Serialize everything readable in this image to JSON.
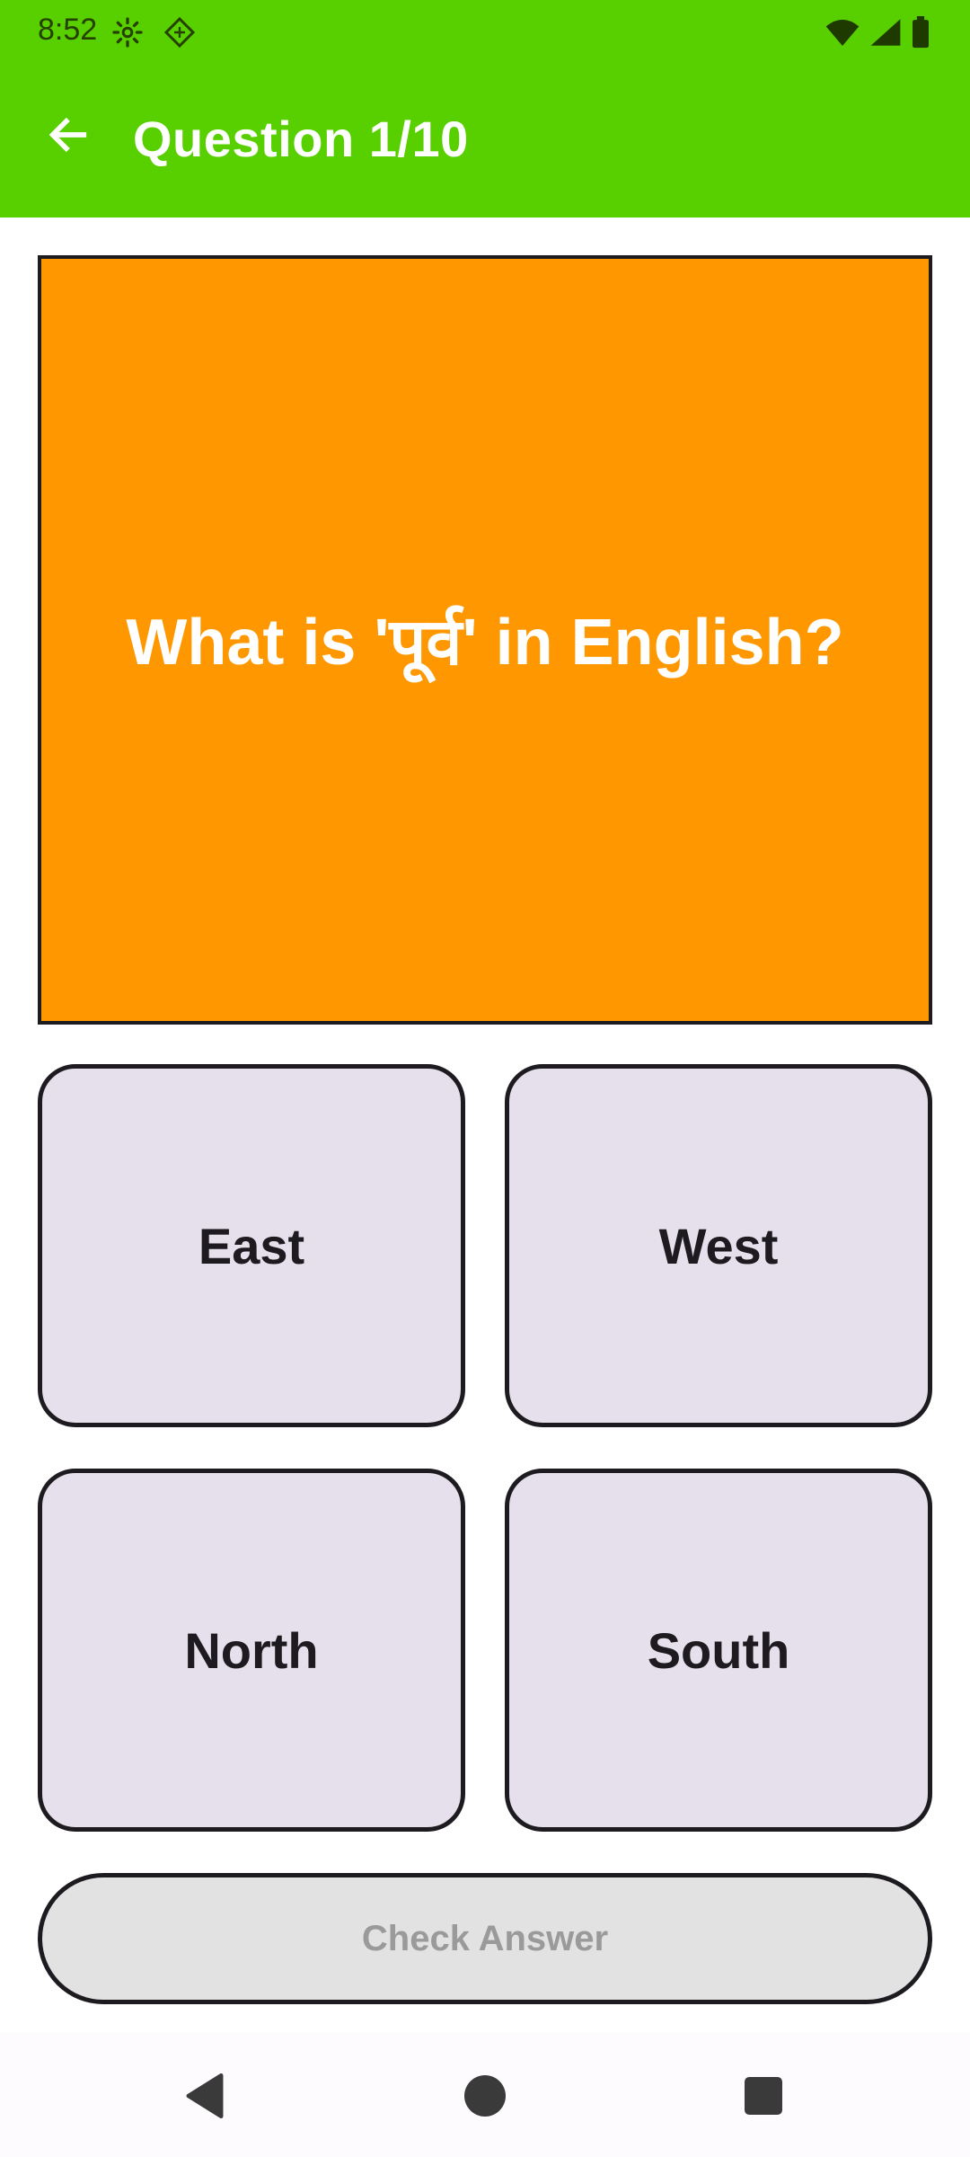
{
  "status_bar": {
    "time": "8:52",
    "icons": [
      "settings-icon",
      "diamond-icon",
      "wifi-icon",
      "signal-icon",
      "battery-icon"
    ]
  },
  "app_bar": {
    "title": "Question 1/10",
    "back_icon": "arrow-left-icon",
    "background": "#58d000"
  },
  "question": {
    "text": "What is 'पूर्व' in English?",
    "background": "#ff9800"
  },
  "options": [
    {
      "label": "East"
    },
    {
      "label": "West"
    },
    {
      "label": "North"
    },
    {
      "label": "South"
    }
  ],
  "check_button": {
    "label": "Check Answer",
    "state": "disabled"
  },
  "nav_bar": {
    "icons": [
      "nav-back-icon",
      "nav-home-icon",
      "nav-recents-icon"
    ]
  }
}
